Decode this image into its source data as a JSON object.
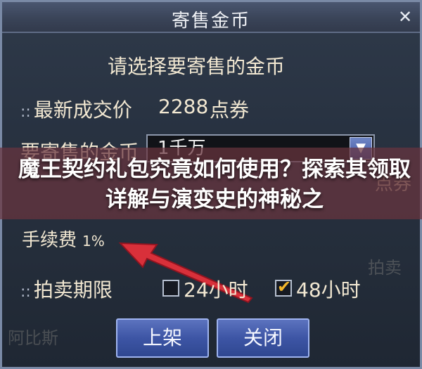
{
  "window": {
    "title": "寄售金币",
    "close_icon": "close-icon"
  },
  "form": {
    "heading": "请选择要寄售的金币",
    "prefix": "::",
    "latest_price_label": "最新成交价",
    "latest_price_value": "2288",
    "latest_price_unit": "点券",
    "amount_label": "要寄售的金币",
    "amount_selected": "1千万",
    "price_unit_right": "点券",
    "fee_label": "手续费",
    "fee_value": "1%",
    "duration_label": "拍卖期限",
    "duration_24": "24小时",
    "duration_48": "48小时",
    "duration_24_checked": false,
    "duration_48_checked": true
  },
  "buttons": {
    "list": "上架",
    "close": "关闭"
  },
  "overlay": {
    "text": "魔王契约礼包究竟如何使用？探索其领取详解与演变史的神秘之"
  },
  "background_text": {
    "left_bottom": "阿比斯",
    "right_partial": "拍卖"
  },
  "colors": {
    "arrow": "#d8303a",
    "checkmark": "#f3b72a",
    "button": "#3d55a5"
  }
}
